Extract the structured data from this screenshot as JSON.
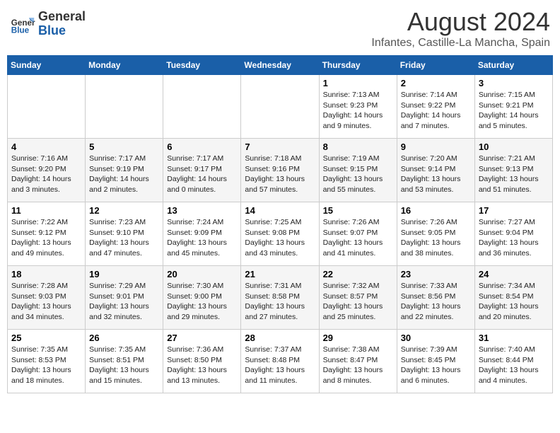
{
  "header": {
    "logo_general": "General",
    "logo_blue": "Blue",
    "title": "August 2024",
    "subtitle": "Infantes, Castille-La Mancha, Spain"
  },
  "columns": [
    "Sunday",
    "Monday",
    "Tuesday",
    "Wednesday",
    "Thursday",
    "Friday",
    "Saturday"
  ],
  "weeks": [
    {
      "days": [
        {
          "num": "",
          "info": ""
        },
        {
          "num": "",
          "info": ""
        },
        {
          "num": "",
          "info": ""
        },
        {
          "num": "",
          "info": ""
        },
        {
          "num": "1",
          "info": "Sunrise: 7:13 AM\nSunset: 9:23 PM\nDaylight: 14 hours\nand 9 minutes."
        },
        {
          "num": "2",
          "info": "Sunrise: 7:14 AM\nSunset: 9:22 PM\nDaylight: 14 hours\nand 7 minutes."
        },
        {
          "num": "3",
          "info": "Sunrise: 7:15 AM\nSunset: 9:21 PM\nDaylight: 14 hours\nand 5 minutes."
        }
      ]
    },
    {
      "days": [
        {
          "num": "4",
          "info": "Sunrise: 7:16 AM\nSunset: 9:20 PM\nDaylight: 14 hours\nand 3 minutes."
        },
        {
          "num": "5",
          "info": "Sunrise: 7:17 AM\nSunset: 9:19 PM\nDaylight: 14 hours\nand 2 minutes."
        },
        {
          "num": "6",
          "info": "Sunrise: 7:17 AM\nSunset: 9:17 PM\nDaylight: 14 hours\nand 0 minutes."
        },
        {
          "num": "7",
          "info": "Sunrise: 7:18 AM\nSunset: 9:16 PM\nDaylight: 13 hours\nand 57 minutes."
        },
        {
          "num": "8",
          "info": "Sunrise: 7:19 AM\nSunset: 9:15 PM\nDaylight: 13 hours\nand 55 minutes."
        },
        {
          "num": "9",
          "info": "Sunrise: 7:20 AM\nSunset: 9:14 PM\nDaylight: 13 hours\nand 53 minutes."
        },
        {
          "num": "10",
          "info": "Sunrise: 7:21 AM\nSunset: 9:13 PM\nDaylight: 13 hours\nand 51 minutes."
        }
      ]
    },
    {
      "days": [
        {
          "num": "11",
          "info": "Sunrise: 7:22 AM\nSunset: 9:12 PM\nDaylight: 13 hours\nand 49 minutes."
        },
        {
          "num": "12",
          "info": "Sunrise: 7:23 AM\nSunset: 9:10 PM\nDaylight: 13 hours\nand 47 minutes."
        },
        {
          "num": "13",
          "info": "Sunrise: 7:24 AM\nSunset: 9:09 PM\nDaylight: 13 hours\nand 45 minutes."
        },
        {
          "num": "14",
          "info": "Sunrise: 7:25 AM\nSunset: 9:08 PM\nDaylight: 13 hours\nand 43 minutes."
        },
        {
          "num": "15",
          "info": "Sunrise: 7:26 AM\nSunset: 9:07 PM\nDaylight: 13 hours\nand 41 minutes."
        },
        {
          "num": "16",
          "info": "Sunrise: 7:26 AM\nSunset: 9:05 PM\nDaylight: 13 hours\nand 38 minutes."
        },
        {
          "num": "17",
          "info": "Sunrise: 7:27 AM\nSunset: 9:04 PM\nDaylight: 13 hours\nand 36 minutes."
        }
      ]
    },
    {
      "days": [
        {
          "num": "18",
          "info": "Sunrise: 7:28 AM\nSunset: 9:03 PM\nDaylight: 13 hours\nand 34 minutes."
        },
        {
          "num": "19",
          "info": "Sunrise: 7:29 AM\nSunset: 9:01 PM\nDaylight: 13 hours\nand 32 minutes."
        },
        {
          "num": "20",
          "info": "Sunrise: 7:30 AM\nSunset: 9:00 PM\nDaylight: 13 hours\nand 29 minutes."
        },
        {
          "num": "21",
          "info": "Sunrise: 7:31 AM\nSunset: 8:58 PM\nDaylight: 13 hours\nand 27 minutes."
        },
        {
          "num": "22",
          "info": "Sunrise: 7:32 AM\nSunset: 8:57 PM\nDaylight: 13 hours\nand 25 minutes."
        },
        {
          "num": "23",
          "info": "Sunrise: 7:33 AM\nSunset: 8:56 PM\nDaylight: 13 hours\nand 22 minutes."
        },
        {
          "num": "24",
          "info": "Sunrise: 7:34 AM\nSunset: 8:54 PM\nDaylight: 13 hours\nand 20 minutes."
        }
      ]
    },
    {
      "days": [
        {
          "num": "25",
          "info": "Sunrise: 7:35 AM\nSunset: 8:53 PM\nDaylight: 13 hours\nand 18 minutes."
        },
        {
          "num": "26",
          "info": "Sunrise: 7:35 AM\nSunset: 8:51 PM\nDaylight: 13 hours\nand 15 minutes."
        },
        {
          "num": "27",
          "info": "Sunrise: 7:36 AM\nSunset: 8:50 PM\nDaylight: 13 hours\nand 13 minutes."
        },
        {
          "num": "28",
          "info": "Sunrise: 7:37 AM\nSunset: 8:48 PM\nDaylight: 13 hours\nand 11 minutes."
        },
        {
          "num": "29",
          "info": "Sunrise: 7:38 AM\nSunset: 8:47 PM\nDaylight: 13 hours\nand 8 minutes."
        },
        {
          "num": "30",
          "info": "Sunrise: 7:39 AM\nSunset: 8:45 PM\nDaylight: 13 hours\nand 6 minutes."
        },
        {
          "num": "31",
          "info": "Sunrise: 7:40 AM\nSunset: 8:44 PM\nDaylight: 13 hours\nand 4 minutes."
        }
      ]
    }
  ]
}
